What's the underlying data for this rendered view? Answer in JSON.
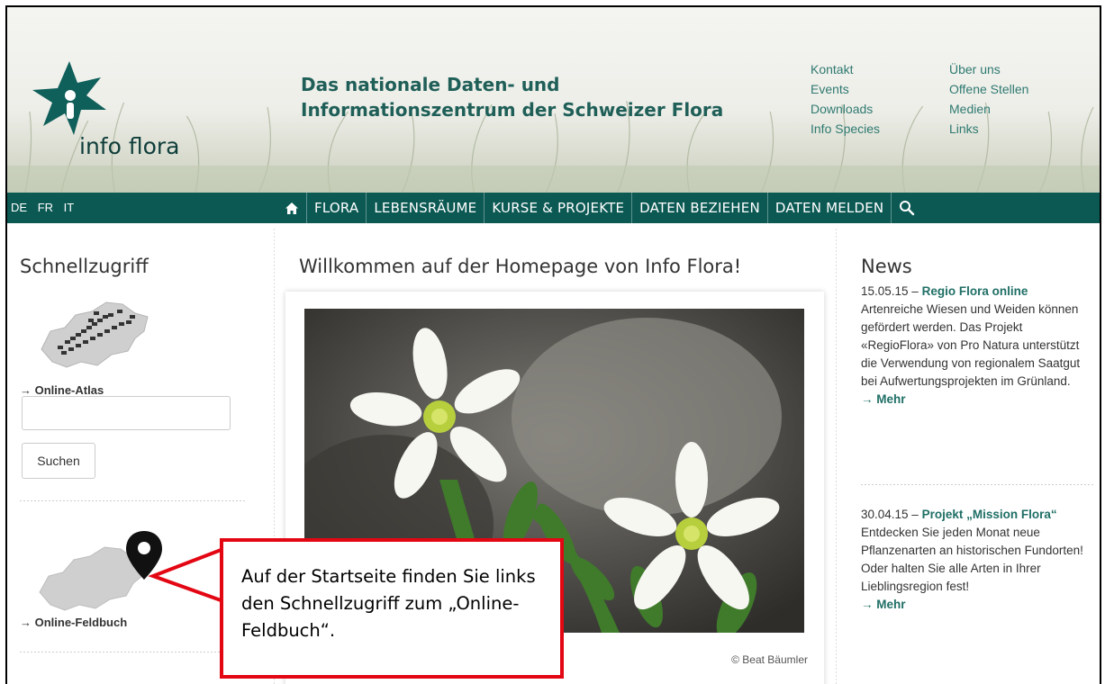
{
  "header": {
    "logo_text": "info flora",
    "tagline_line1": "Das nationale Daten- und",
    "tagline_line2": "Informationszentrum der Schweizer Flora",
    "links_col1": [
      "Kontakt",
      "Events",
      "Downloads",
      "Info Species"
    ],
    "links_col2": [
      "Über uns",
      "Offene Stellen",
      "Medien",
      "Links"
    ]
  },
  "nav": {
    "languages": [
      "DE",
      "FR",
      "IT"
    ],
    "items": [
      "FLORA",
      "LEBENSRÄUME",
      "KURSE & PROJEKTE",
      "DATEN BEZIEHEN",
      "DATEN MELDEN"
    ],
    "home_icon": "home-icon",
    "search_icon": "search-icon"
  },
  "left": {
    "title": "Schnellzugriff",
    "atlas_link": "→ Online-Atlas",
    "search_value": "",
    "search_button": "Suchen",
    "feldbuch_link": "→ Online-Feldbuch"
  },
  "center": {
    "title": "Willkommen auf der Homepage von Info Flora!",
    "photo_credit": "© Beat Bäumler"
  },
  "news": {
    "title": "News",
    "items": [
      {
        "date": "15.05.15 –",
        "headline": "Regio Flora online",
        "body": "Artenreiche Wiesen und Weiden können gefördert werden. Das Projekt «RegioFlora» von Pro Natura unterstützt die Verwendung von regionalem Saatgut bei Aufwertungsprojekten im Grünland.",
        "more": "→ Mehr"
      },
      {
        "date": "30.04.15 –",
        "headline": "Projekt „Mission Flora“",
        "body": "Entdecken Sie jeden Monat neue Pflanzenarten an historischen Fundorten! Oder halten Sie alle Arten in Ihrer Lieblingsregion fest!",
        "more": "→ Mehr"
      }
    ]
  },
  "callout": {
    "text": "Auf der Startseite finden Sie links den Schnellzugriff zum „Online-Feldbuch“."
  },
  "colors": {
    "nav_bg": "#0c5954",
    "accent": "#1f6f66",
    "callout_border": "#e30613"
  }
}
